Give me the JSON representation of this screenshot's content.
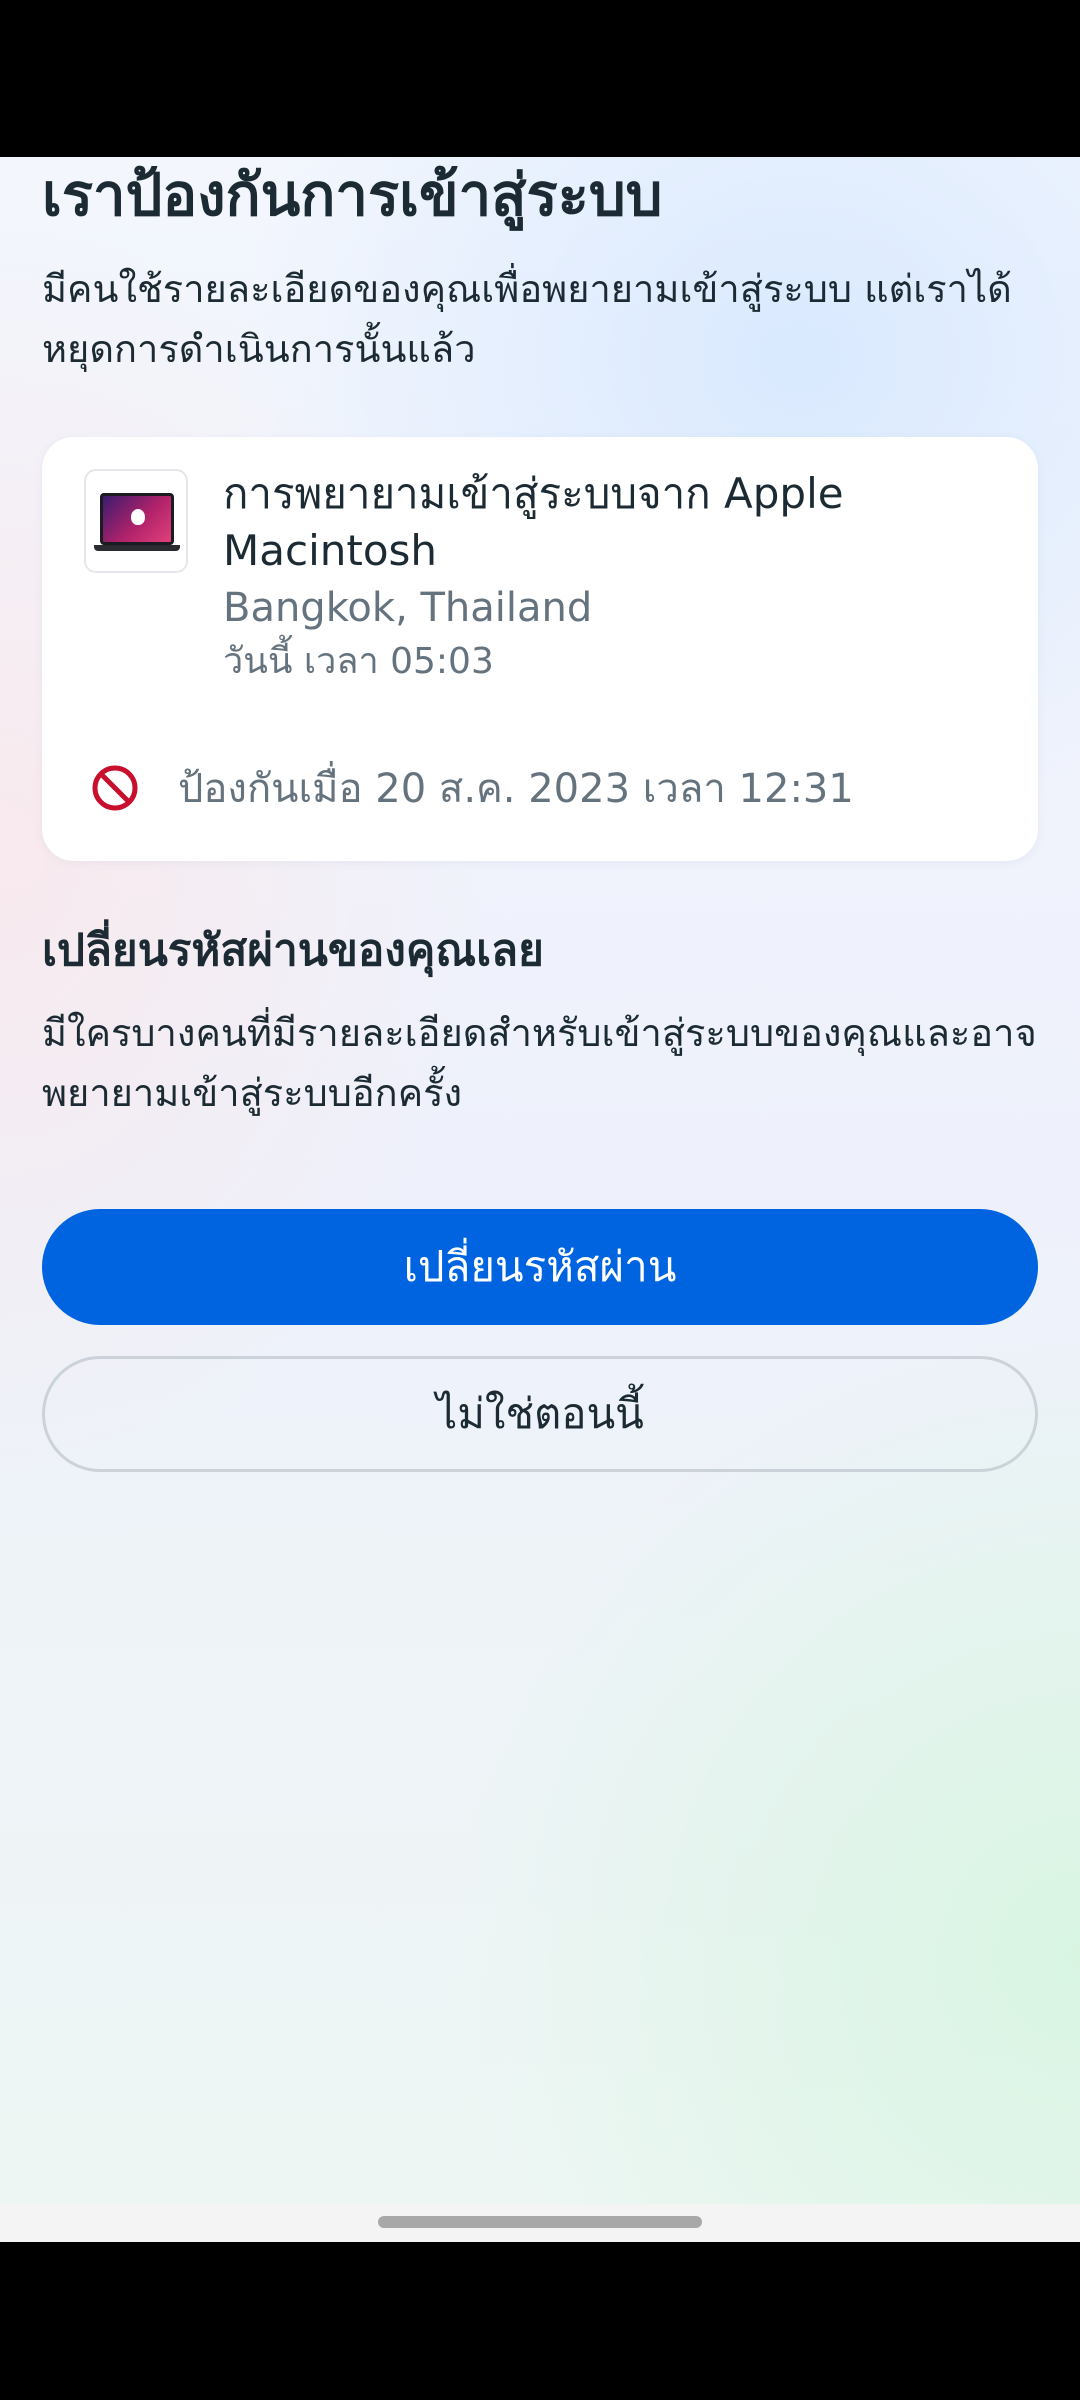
{
  "header": {
    "title": "เราป้องกันการเข้าสู่ระบบ",
    "description": "มีคนใช้รายละเอียดของคุณเพื่อพยายามเข้าสู่ระบบ แต่เราได้หยุดการดำเนินการนั้นแล้ว"
  },
  "login_attempt": {
    "device_icon": "macbook-icon",
    "title": "การพยายามเข้าสู่ระบบจาก Apple Macintosh",
    "location": "Bangkok, Thailand",
    "time": "วันนี้ เวลา 05:03",
    "blocked_icon": "blocked-icon",
    "blocked_text": "ป้องกันเมื่อ 20 ส.ค. 2023 เวลา 12:31"
  },
  "advice": {
    "title": "เปลี่ยนรหัสผ่านของคุณเลย",
    "description": "มีใครบางคนที่มีรายละเอียดสำหรับเข้าสู่ระบบของคุณและอาจพยายามเข้าสู่ระบบอีกครั้ง"
  },
  "actions": {
    "primary_label": "เปลี่ยนรหัสผ่าน",
    "secondary_label": "ไม่ใช่ตอนนี้"
  },
  "colors": {
    "primary_button": "#0064e0",
    "blocked_icon": "#c8102e",
    "text_primary": "#1c2b33",
    "text_secondary": "#65737e"
  }
}
